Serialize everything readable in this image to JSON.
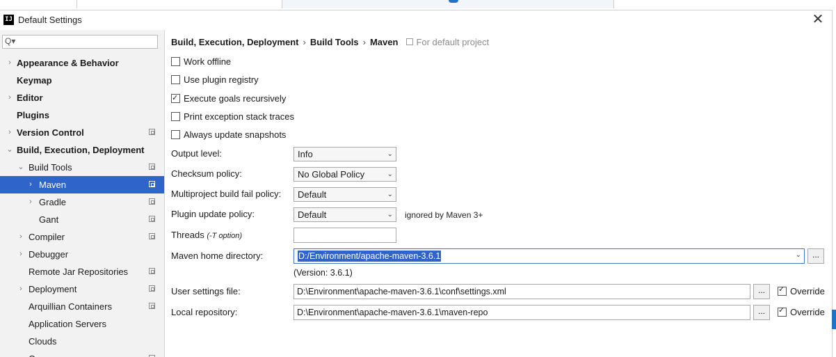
{
  "window": {
    "title": "Default Settings",
    "app_icon_text": "IJ",
    "close_glyph": "✕"
  },
  "sidebar": {
    "search_glyph": "Q▾",
    "items": [
      {
        "label": "Appearance & Behavior",
        "level": 0,
        "arrow": "›",
        "bold": true,
        "project": false
      },
      {
        "label": "Keymap",
        "level": 0,
        "arrow": "",
        "bold": true,
        "project": false
      },
      {
        "label": "Editor",
        "level": 0,
        "arrow": "›",
        "bold": true,
        "project": false
      },
      {
        "label": "Plugins",
        "level": 0,
        "arrow": "",
        "bold": true,
        "project": false
      },
      {
        "label": "Version Control",
        "level": 0,
        "arrow": "›",
        "bold": true,
        "project": true
      },
      {
        "label": "Build, Execution, Deployment",
        "level": 0,
        "arrow": "⌄",
        "bold": true,
        "project": false
      },
      {
        "label": "Build Tools",
        "level": 1,
        "arrow": "⌄",
        "bold": false,
        "project": true
      },
      {
        "label": "Maven",
        "level": 2,
        "arrow": "›",
        "bold": false,
        "project": true,
        "selected": true
      },
      {
        "label": "Gradle",
        "level": 2,
        "arrow": "›",
        "bold": false,
        "project": true
      },
      {
        "label": "Gant",
        "level": 2,
        "arrow": "",
        "bold": false,
        "project": true
      },
      {
        "label": "Compiler",
        "level": 1,
        "arrow": "›",
        "bold": false,
        "project": true
      },
      {
        "label": "Debugger",
        "level": 1,
        "arrow": "›",
        "bold": false,
        "project": false
      },
      {
        "label": "Remote Jar Repositories",
        "level": 1,
        "arrow": "",
        "bold": false,
        "project": true
      },
      {
        "label": "Deployment",
        "level": 1,
        "arrow": "›",
        "bold": false,
        "project": true
      },
      {
        "label": "Arquillian Containers",
        "level": 1,
        "arrow": "",
        "bold": false,
        "project": true
      },
      {
        "label": "Application Servers",
        "level": 1,
        "arrow": "",
        "bold": false,
        "project": false
      },
      {
        "label": "Clouds",
        "level": 1,
        "arrow": "",
        "bold": false,
        "project": false
      },
      {
        "label": "Coverage",
        "level": 1,
        "arrow": "",
        "bold": false,
        "project": true
      }
    ]
  },
  "breadcrumb": {
    "parts": [
      "Build, Execution, Deployment",
      "Build Tools",
      "Maven"
    ],
    "sep": "›",
    "scope": "For default project"
  },
  "checkboxes": [
    {
      "label": "Work offline",
      "checked": false
    },
    {
      "label": "Use plugin registry",
      "checked": false
    },
    {
      "label": "Execute goals recursively",
      "checked": true
    },
    {
      "label": "Print exception stack traces",
      "checked": false
    },
    {
      "label": "Always update snapshots",
      "checked": false
    }
  ],
  "form": {
    "output_level": {
      "label": "Output level:",
      "value": "Info"
    },
    "checksum_policy": {
      "label": "Checksum policy:",
      "value": "No Global Policy"
    },
    "multiproject_fail": {
      "label": "Multiproject build fail policy:",
      "value": "Default"
    },
    "plugin_update": {
      "label": "Plugin update policy:",
      "value": "Default",
      "note": "ignored by Maven 3+"
    },
    "threads": {
      "label": "Threads",
      "hint": "(-T option)",
      "value": ""
    },
    "maven_home": {
      "label": "Maven home directory:",
      "value": "D:/Environment/apache-maven-3.6.1",
      "version": "(Version: 3.6.1)"
    },
    "user_settings": {
      "label": "User settings file:",
      "value": "D:\\Environment\\apache-maven-3.6.1\\conf\\settings.xml",
      "override": "Override",
      "override_checked": true
    },
    "local_repo": {
      "label": "Local repository:",
      "value": "D:\\Environment\\apache-maven-3.6.1\\maven-repo",
      "override": "Override",
      "override_checked": true
    },
    "browse_label": "...",
    "dropdown_glyph": "⌄"
  },
  "colors": {
    "selection": "#2f65ca",
    "sidebar_bg": "#f2f2f2",
    "accent": "#1e73c8"
  }
}
